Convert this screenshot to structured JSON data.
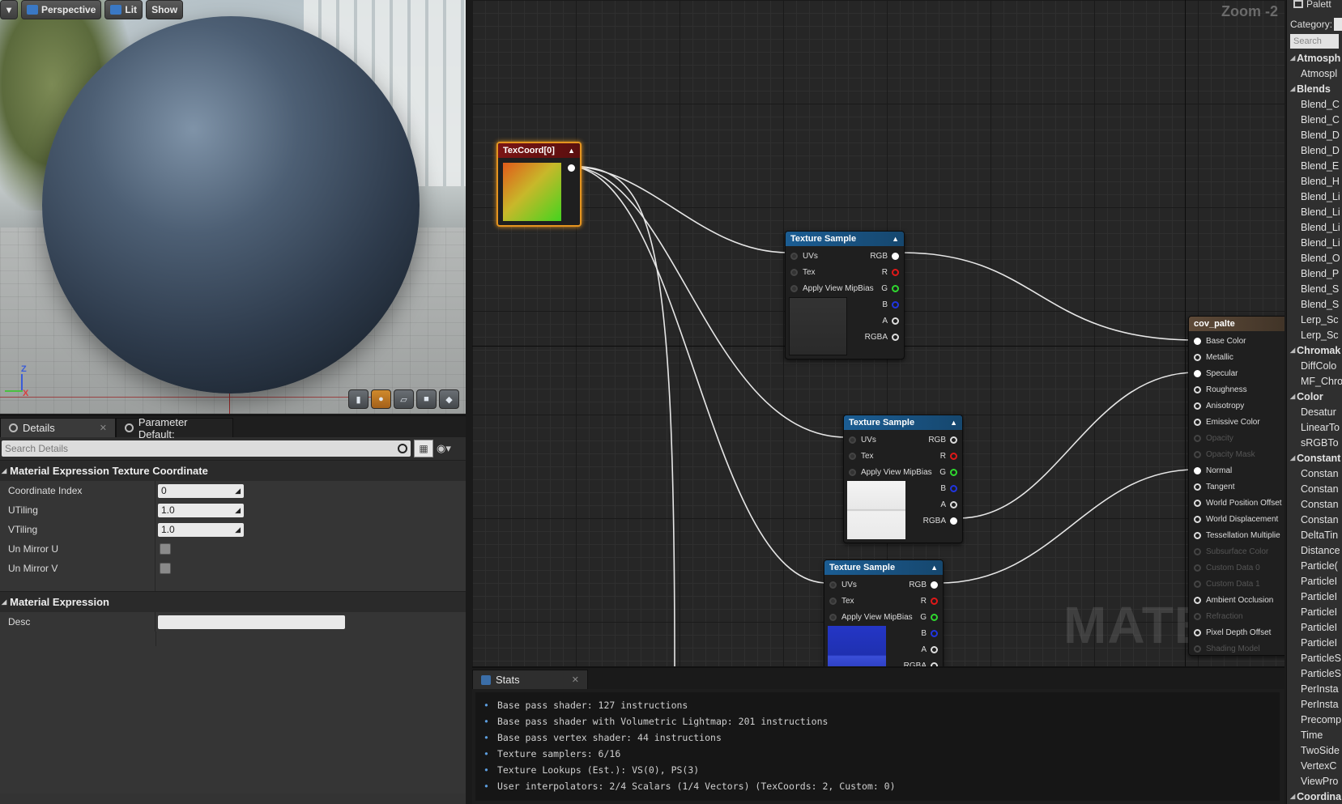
{
  "viewport": {
    "toolbar": {
      "perspective": "Perspective",
      "lit": "Lit",
      "show": "Show"
    },
    "axes": {
      "z": "Z",
      "x": "X"
    }
  },
  "details": {
    "tabs": [
      {
        "label": "Details"
      },
      {
        "label": "Parameter Default:"
      }
    ],
    "search_placeholder": "Search Details",
    "sections": {
      "texcoord": {
        "title": "Material Expression Texture Coordinate",
        "coordinate_index": {
          "label": "Coordinate Index",
          "value": "0"
        },
        "utiling": {
          "label": "UTiling",
          "value": "1.0"
        },
        "vtiling": {
          "label": "VTiling",
          "value": "1.0"
        },
        "un_mirror_u": {
          "label": "Un Mirror U"
        },
        "un_mirror_v": {
          "label": "Un Mirror V"
        }
      },
      "expression": {
        "title": "Material Expression",
        "desc_label": "Desc"
      }
    }
  },
  "graph": {
    "zoom": "Zoom -2",
    "watermark": "MATERIAL",
    "texcoord_node": {
      "title": "TexCoord[0]"
    },
    "texture_sample": {
      "title": "Texture Sample",
      "inputs": [
        "UVs",
        "Tex",
        "Apply View MipBias"
      ],
      "outputs": [
        "RGB",
        "R",
        "G",
        "B",
        "A",
        "RGBA"
      ]
    },
    "result_node": {
      "title": "cov_palte",
      "pins": [
        {
          "label": "Base Color",
          "enabled": true
        },
        {
          "label": "Metallic",
          "enabled": true
        },
        {
          "label": "Specular",
          "enabled": true
        },
        {
          "label": "Roughness",
          "enabled": true
        },
        {
          "label": "Anisotropy",
          "enabled": true
        },
        {
          "label": "Emissive Color",
          "enabled": true
        },
        {
          "label": "Opacity",
          "enabled": false
        },
        {
          "label": "Opacity Mask",
          "enabled": false
        },
        {
          "label": "Normal",
          "enabled": true
        },
        {
          "label": "Tangent",
          "enabled": true
        },
        {
          "label": "World Position Offset",
          "enabled": true
        },
        {
          "label": "World Displacement",
          "enabled": true
        },
        {
          "label": "Tessellation Multiplie",
          "enabled": true
        },
        {
          "label": "Subsurface Color",
          "enabled": false
        },
        {
          "label": "Custom Data 0",
          "enabled": false
        },
        {
          "label": "Custom Data 1",
          "enabled": false
        },
        {
          "label": "Ambient Occlusion",
          "enabled": true
        },
        {
          "label": "Refraction",
          "enabled": false
        },
        {
          "label": "Pixel Depth Offset",
          "enabled": true
        },
        {
          "label": "Shading Model",
          "enabled": false
        }
      ]
    }
  },
  "stats": {
    "tab": "Stats",
    "lines": [
      "Base pass shader: 127 instructions",
      "Base pass shader with Volumetric Lightmap: 201 instructions",
      "Base pass vertex shader: 44 instructions",
      "Texture samplers: 6/16",
      "Texture Lookups (Est.): VS(0), PS(3)",
      "User interpolators: 2/4 Scalars (1/4 Vectors) (TexCoords: 2, Custom: 0)"
    ]
  },
  "palette": {
    "title": "Palett",
    "category_label": "Category:",
    "search_placeholder": "Search",
    "items": [
      {
        "type": "cat",
        "label": "Atmosph"
      },
      {
        "type": "entry",
        "label": "Atmospl"
      },
      {
        "type": "cat",
        "label": "Blends"
      },
      {
        "type": "entry",
        "label": "Blend_C"
      },
      {
        "type": "entry",
        "label": "Blend_C"
      },
      {
        "type": "entry",
        "label": "Blend_D"
      },
      {
        "type": "entry",
        "label": "Blend_D"
      },
      {
        "type": "entry",
        "label": "Blend_E"
      },
      {
        "type": "entry",
        "label": "Blend_H"
      },
      {
        "type": "entry",
        "label": "Blend_Li"
      },
      {
        "type": "entry",
        "label": "Blend_Li"
      },
      {
        "type": "entry",
        "label": "Blend_Li"
      },
      {
        "type": "entry",
        "label": "Blend_Li"
      },
      {
        "type": "entry",
        "label": "Blend_O"
      },
      {
        "type": "entry",
        "label": "Blend_P"
      },
      {
        "type": "entry",
        "label": "Blend_S"
      },
      {
        "type": "entry",
        "label": "Blend_S"
      },
      {
        "type": "entry",
        "label": "Lerp_Sc"
      },
      {
        "type": "entry",
        "label": "Lerp_Sc"
      },
      {
        "type": "cat",
        "label": "Chromak"
      },
      {
        "type": "entry",
        "label": "DiffColo"
      },
      {
        "type": "entry",
        "label": "MF_Chro"
      },
      {
        "type": "cat",
        "label": "Color"
      },
      {
        "type": "entry",
        "label": "Desatur"
      },
      {
        "type": "entry",
        "label": "LinearTo"
      },
      {
        "type": "entry",
        "label": "sRGBTo"
      },
      {
        "type": "cat",
        "label": "Constant"
      },
      {
        "type": "entry",
        "label": "Constan"
      },
      {
        "type": "entry",
        "label": "Constan"
      },
      {
        "type": "entry",
        "label": "Constan"
      },
      {
        "type": "entry",
        "label": "Constan"
      },
      {
        "type": "entry",
        "label": "DeltaTin"
      },
      {
        "type": "entry",
        "label": "Distance"
      },
      {
        "type": "entry",
        "label": "Particle("
      },
      {
        "type": "entry",
        "label": "ParticleI"
      },
      {
        "type": "entry",
        "label": "ParticleI"
      },
      {
        "type": "entry",
        "label": "ParticleI"
      },
      {
        "type": "entry",
        "label": "ParticleI"
      },
      {
        "type": "entry",
        "label": "ParticleI"
      },
      {
        "type": "entry",
        "label": "ParticleS"
      },
      {
        "type": "entry",
        "label": "ParticleS"
      },
      {
        "type": "entry",
        "label": "PerInsta"
      },
      {
        "type": "entry",
        "label": "PerInsta"
      },
      {
        "type": "entry",
        "label": "Precomp"
      },
      {
        "type": "entry",
        "label": "Time"
      },
      {
        "type": "entry",
        "label": "TwoSide"
      },
      {
        "type": "entry",
        "label": "VertexC"
      },
      {
        "type": "entry",
        "label": "ViewPro"
      },
      {
        "type": "cat",
        "label": "Coordina"
      }
    ]
  }
}
